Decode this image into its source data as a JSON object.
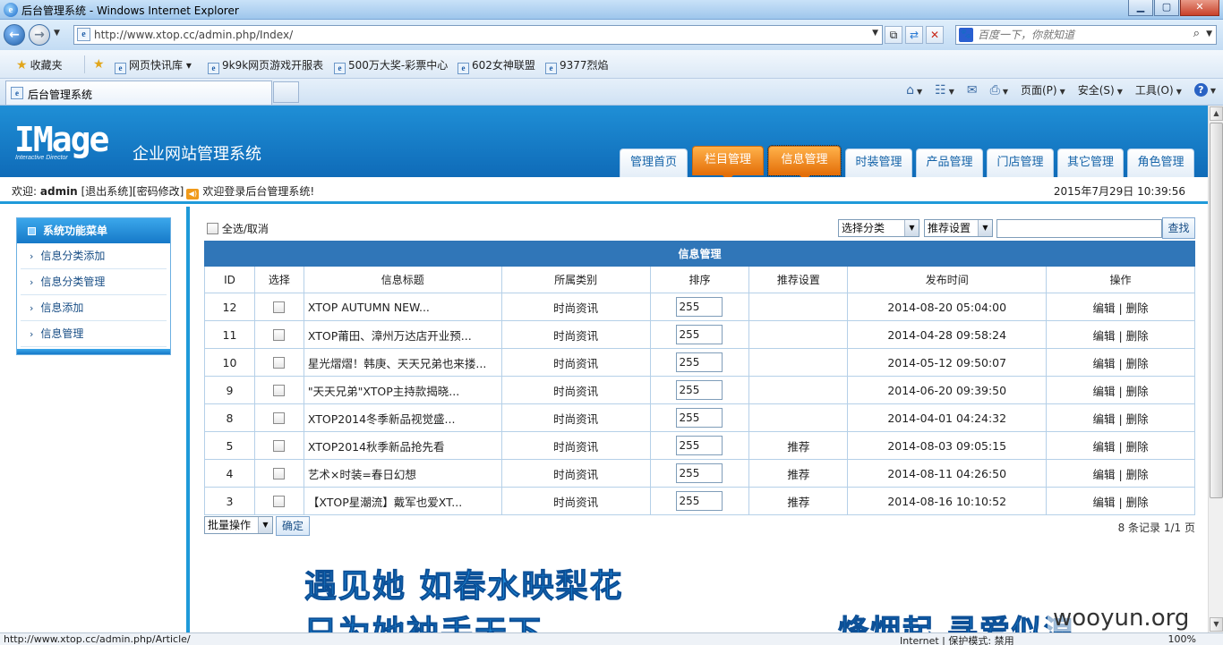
{
  "window": {
    "title": "后台管理系统 - Windows Internet Explorer",
    "icon": "internet-explorer-icon",
    "buttons": [
      "minimize",
      "maximize",
      "close"
    ]
  },
  "browser": {
    "address": "http://www.xtop.cc/admin.php/Index/",
    "search_placeholder": "百度一下，你就知道",
    "favorites_label": "收藏夹",
    "favorites": [
      "网页快讯库",
      "9k9k网页游戏开服表",
      "500万大奖-彩票中心",
      "602女神联盟",
      "9377烈焰"
    ],
    "tab_title": "后台管理系统",
    "commands": {
      "page": "页面(P)",
      "safety": "安全(S)",
      "tools": "工具(O)"
    }
  },
  "app": {
    "logo": "IMage",
    "logo_sub": "Interactive Director",
    "system_title": "企业网站管理系统",
    "nav": [
      {
        "label": "管理首页",
        "active": false
      },
      {
        "label": "栏目管理",
        "active": true
      },
      {
        "label": "信息管理",
        "active": true
      },
      {
        "label": "时装管理",
        "active": false
      },
      {
        "label": "产品管理",
        "active": false
      },
      {
        "label": "门店管理",
        "active": false
      },
      {
        "label": "其它管理",
        "active": false
      },
      {
        "label": "角色管理",
        "active": false
      }
    ],
    "welcome": {
      "prefix": "欢迎:",
      "user": "admin",
      "logout": "[退出系统]",
      "change_pwd": "[密码修改]",
      "message": "欢迎登录后台管理系统!",
      "datetime": "2015年7月29日 10:39:56"
    },
    "accent_color": "#1f9ad9",
    "active_tab_color": "#f0851c"
  },
  "sidebar": {
    "title": "系统功能菜单",
    "items": [
      "信息分类添加",
      "信息分类管理",
      "信息添加",
      "信息管理"
    ]
  },
  "content": {
    "select_all": "全选/取消",
    "category_select": "选择分类",
    "recommend_select": "推荐设置",
    "search_button": "查找",
    "table_caption": "信息管理",
    "columns": [
      "ID",
      "选择",
      "信息标题",
      "所属类别",
      "排序",
      "推荐设置",
      "发布时间",
      "操作"
    ],
    "rows": [
      {
        "id": "12",
        "title": "XTOP AUTUMN NEW...",
        "category": "时尚资讯",
        "order": "255",
        "recommend": "",
        "time": "2014-08-20 05:04:00"
      },
      {
        "id": "11",
        "title": "XTOP莆田、漳州万达店开业预...",
        "category": "时尚资讯",
        "order": "255",
        "recommend": "",
        "time": "2014-04-28 09:58:24"
      },
      {
        "id": "10",
        "title": "星光熠熠！韩庚、天天兄弟也来搂...",
        "category": "时尚资讯",
        "order": "255",
        "recommend": "",
        "time": "2014-05-12 09:50:07"
      },
      {
        "id": "9",
        "title": "\"天天兄弟\"XTOP主持款揭晓...",
        "category": "时尚资讯",
        "order": "255",
        "recommend": "",
        "time": "2014-06-20 09:39:50"
      },
      {
        "id": "8",
        "title": "XTOP2014冬季新品视觉盛...",
        "category": "时尚资讯",
        "order": "255",
        "recommend": "",
        "time": "2014-04-01 04:24:32"
      },
      {
        "id": "5",
        "title": "XTOP2014秋季新品抢先看",
        "category": "时尚资讯",
        "order": "255",
        "recommend": "推荐",
        "time": "2014-08-03 09:05:15"
      },
      {
        "id": "4",
        "title": "艺术×时装=春日幻想",
        "category": "时尚资讯",
        "order": "255",
        "recommend": "推荐",
        "time": "2014-08-11 04:26:50"
      },
      {
        "id": "3",
        "title": "【XTOP星潮流】戴军也爱XT...",
        "category": "时尚资讯",
        "order": "255",
        "recommend": "推荐",
        "time": "2014-08-16 10:10:52"
      }
    ],
    "op_edit": "编辑",
    "op_sep": "|",
    "op_delete": "删除",
    "batch_select": "批量操作",
    "confirm_button": "确定",
    "records": "8 条记录 1/1 页"
  },
  "overlay": {
    "line1": "遇见她 如春水映梨花",
    "line2": "只为她袖手天下",
    "line3": "烽烟起 寻爱似浪",
    "watermark": "wooyun.org"
  },
  "status": {
    "url": "http://www.xtop.cc/admin.php/Article/",
    "zone": "Internet | 保护模式: 禁用",
    "zoom": "100%"
  }
}
